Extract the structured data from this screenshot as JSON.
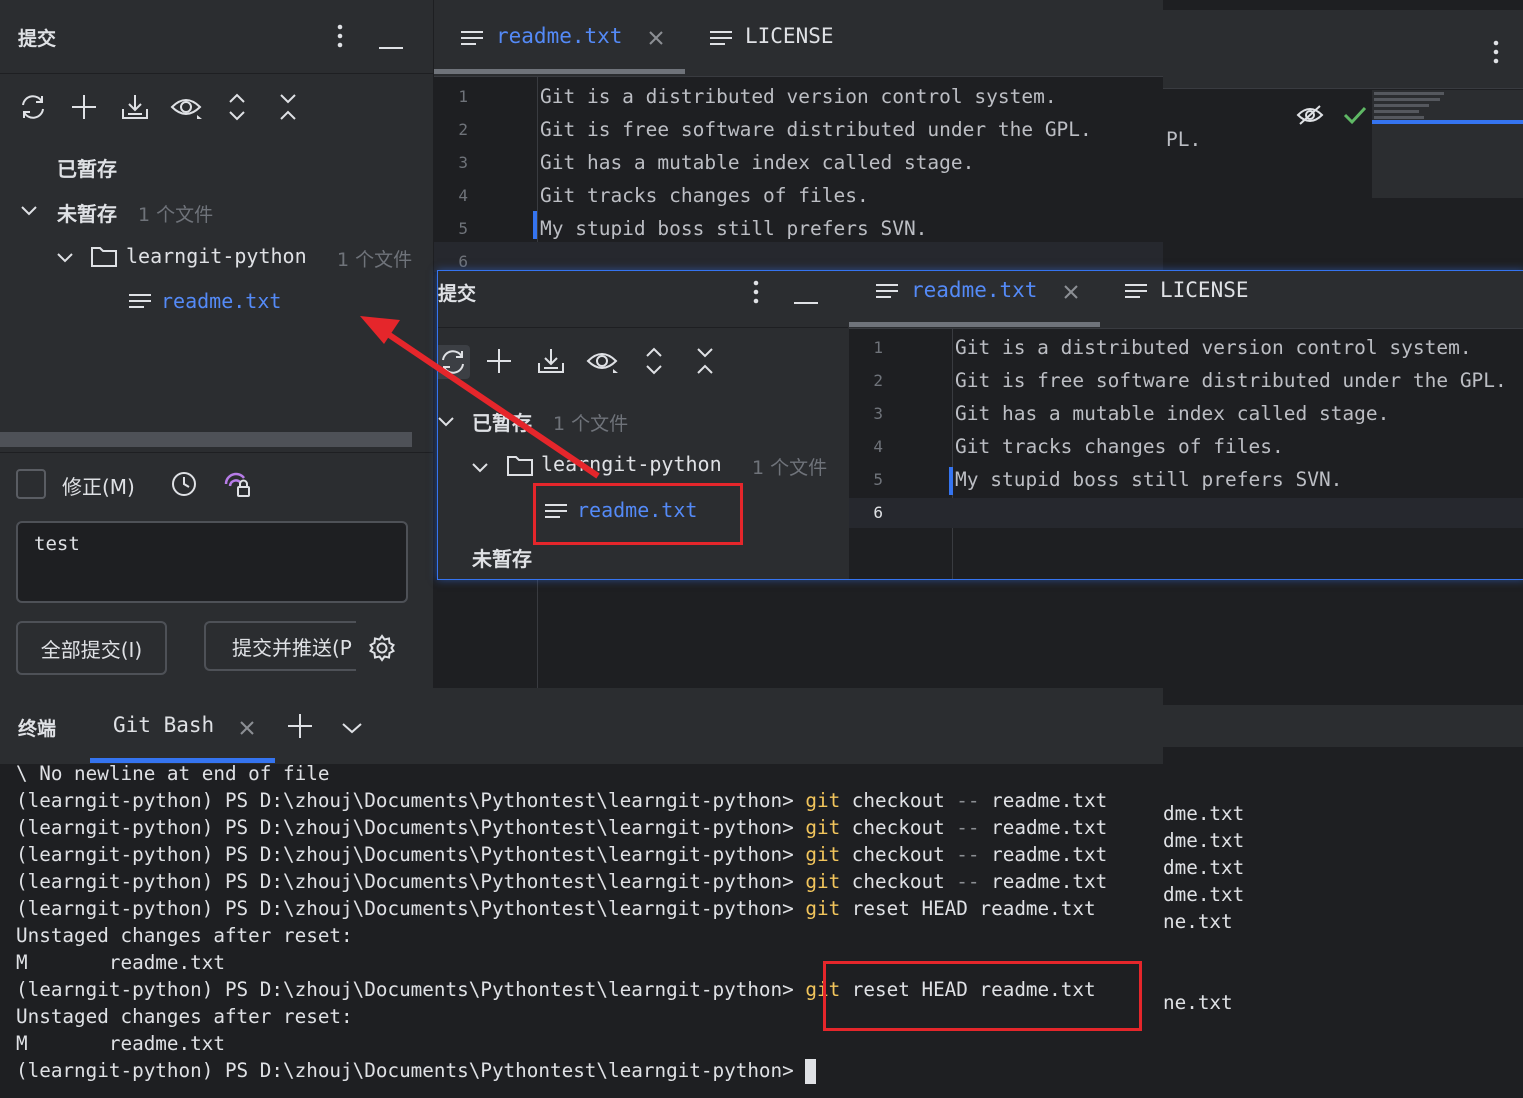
{
  "commit_panel": {
    "title": "提交",
    "staged_label": "已暂存",
    "unstaged_label": "未暂存",
    "unstaged_count": "1 个文件",
    "folder_name": "learngit-python",
    "folder_count": "1 个文件",
    "file_name": "readme.txt",
    "amend_label": "修正(M)",
    "message": "test",
    "commit_all_button": "全部提交(I)",
    "commit_push_button": "提交并推送(P"
  },
  "editor": {
    "tabs": [
      {
        "label": "readme.txt",
        "active": true
      },
      {
        "label": "LICENSE",
        "active": false
      }
    ],
    "lines": [
      {
        "num": "1",
        "text": "Git is a distributed version control system."
      },
      {
        "num": "2",
        "text": "Git is free software distributed under the GPL."
      },
      {
        "num": "3",
        "text": "Git has a mutable index called stage."
      },
      {
        "num": "4",
        "text": "Git tracks changes of files."
      },
      {
        "num": "5",
        "text": "My stupid boss still prefers SVN."
      },
      {
        "num": "6",
        "text": ""
      }
    ]
  },
  "overlay": {
    "title": "提交",
    "staged_label": "已暂存",
    "staged_count": "1 个文件",
    "folder_name": "learngit-python",
    "folder_count": "1 个文件",
    "file_name": "readme.txt",
    "unstaged_label": "未暂存",
    "tabs": [
      {
        "label": "readme.txt"
      },
      {
        "label": "LICENSE"
      }
    ]
  },
  "terminal": {
    "title": "终端",
    "tab_label": "Git Bash",
    "prompt": "(learngit-python) PS D:\\zhouj\\Documents\\Pythontest\\learngit-python>",
    "lines": [
      "\\ No newline at end of file",
      "git checkout -- readme.txt",
      "git checkout -- readme.txt",
      "git checkout -- readme.txt",
      "git checkout -- readme.txt",
      "git reset HEAD readme.txt",
      "Unstaged changes after reset:",
      "M       readme.txt",
      "git reset HEAD readme.txt",
      "Unstaged changes after reset:",
      "M       readme.txt"
    ]
  },
  "background_window": {
    "partial_text": "PL.",
    "term_fragments": [
      "dme.txt",
      "dme.txt",
      "dme.txt",
      "dme.txt",
      "ne.txt",
      "ne.txt"
    ]
  },
  "colors": {
    "accent": "#3574f0",
    "git_command": "#f2c55c",
    "annotation_red": "#e5262b",
    "link_blue": "#548af7"
  }
}
